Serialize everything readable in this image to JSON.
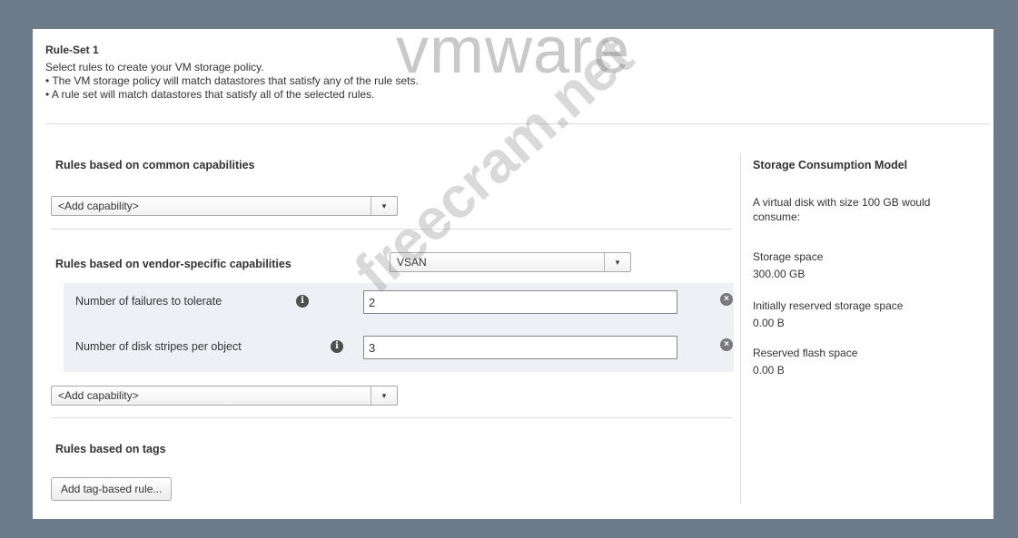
{
  "watermark": {
    "logo": "vmware",
    "overlay": "freecram.net"
  },
  "ruleset": {
    "title": "Rule-Set 1",
    "description": [
      "Select rules to create your VM storage policy.",
      "• The VM storage policy will match datastores that satisfy any of the rule sets.",
      "• A rule set will match datastores that satisfy all of the selected rules."
    ]
  },
  "common": {
    "heading": "Rules based on common capabilities",
    "add_capability": "<Add capability>"
  },
  "vendor": {
    "heading": "Rules based on vendor-specific capabilities",
    "provider": "VSAN",
    "rules": [
      {
        "label": "Number of failures to tolerate",
        "value": "2"
      },
      {
        "label": "Number of disk stripes per object",
        "value": "3"
      }
    ],
    "add_capability": "<Add capability>"
  },
  "tags": {
    "heading": "Rules based on tags",
    "button": "Add tag-based rule..."
  },
  "storage_model": {
    "heading": "Storage Consumption Model",
    "intro": "A virtual disk with size 100 GB would consume:",
    "items": [
      {
        "label": "Storage space",
        "value": "300.00 GB"
      },
      {
        "label": "Initially reserved storage space",
        "value": "0.00 B"
      },
      {
        "label": "Reserved flash space",
        "value": "0.00 B"
      }
    ]
  },
  "icons": {
    "dropdown_arrow": "▾",
    "info": "i",
    "remove": "×"
  },
  "colors": {
    "background": "#6d7a89",
    "panel": "#ffffff",
    "rule_block": "#eef0f5"
  }
}
